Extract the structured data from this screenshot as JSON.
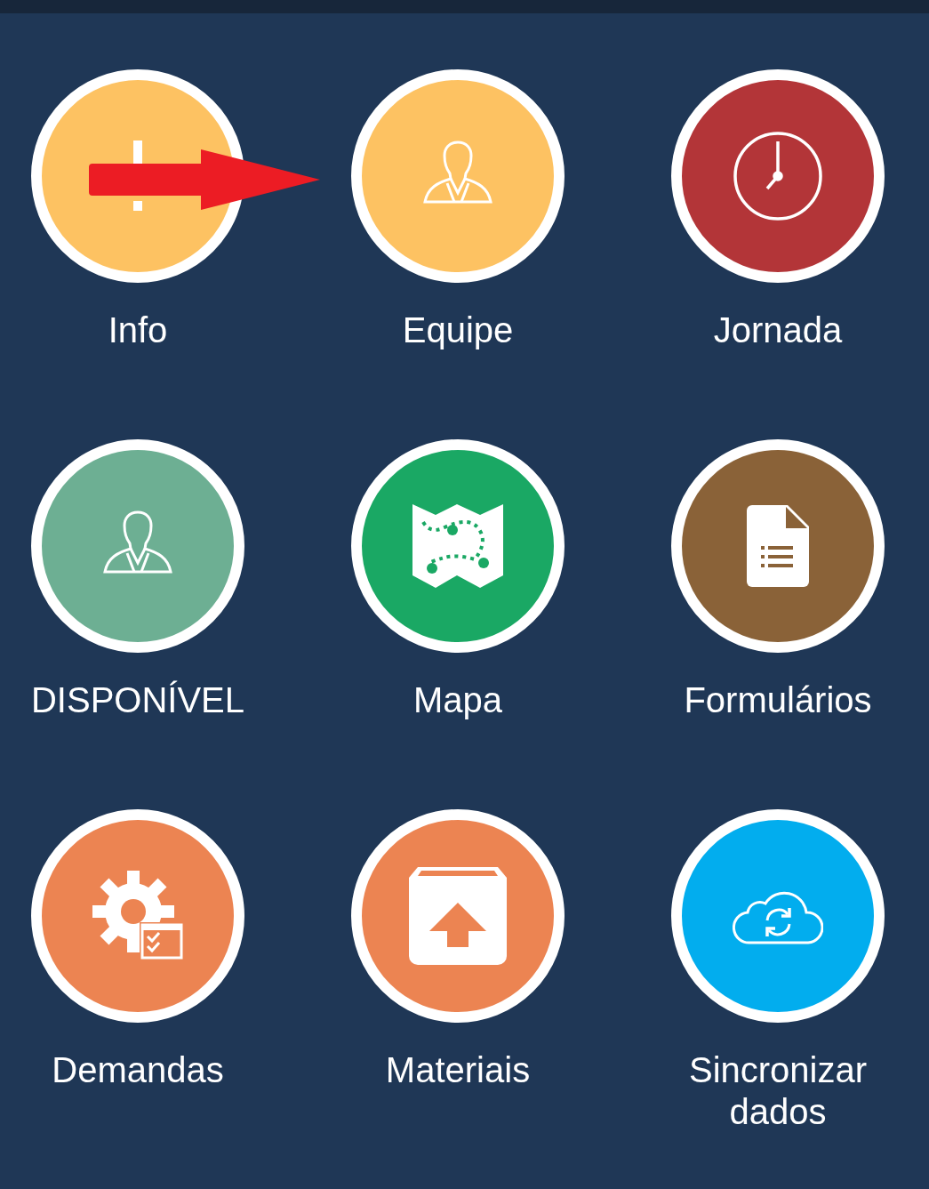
{
  "tiles": [
    {
      "label": "Info",
      "color": "#fdc262",
      "kind": "exclamation"
    },
    {
      "label": "Equipe",
      "color": "#fdc262",
      "kind": "person"
    },
    {
      "label": "Jornada",
      "color": "#b33538",
      "kind": "clock"
    },
    {
      "label": "DISPONÍVEL",
      "color": "#6daf93",
      "kind": "person"
    },
    {
      "label": "Mapa",
      "color": "#1aa864",
      "kind": "map"
    },
    {
      "label": "Formulários",
      "color": "#8a6238",
      "kind": "document"
    },
    {
      "label": "Demandas",
      "color": "#ec8452",
      "kind": "gear"
    },
    {
      "label": "Materiais",
      "color": "#ec8452",
      "kind": "box"
    },
    {
      "label": "Sincronizar dados",
      "color": "#02adee",
      "kind": "cloud"
    }
  ],
  "annotations": [
    {
      "kind": "arrow"
    }
  ]
}
